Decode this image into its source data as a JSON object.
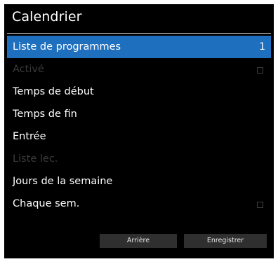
{
  "title": "Calendrier",
  "menu": {
    "items": [
      {
        "label": "Liste de programmes",
        "value": "1"
      },
      {
        "label": "Activé"
      },
      {
        "label": "Temps de début"
      },
      {
        "label": "Temps de fin"
      },
      {
        "label": "Entrée"
      },
      {
        "label": "Liste lec."
      },
      {
        "label": "Jours de la semaine"
      },
      {
        "label": "Chaque sem."
      }
    ]
  },
  "checkboxes": {
    "enabled_checked": false,
    "weekly_checked": false
  },
  "buttons": {
    "back_label": "Arrière",
    "save_label": "Enregistrer"
  },
  "colors": {
    "selection": "#1f6fbf",
    "background": "#000000",
    "button": "#2f2f2f",
    "disabled_text": "#3a3a3a"
  }
}
